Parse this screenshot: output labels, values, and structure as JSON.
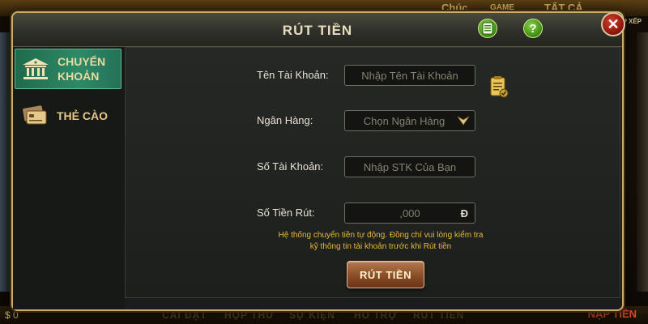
{
  "background": {
    "top_labels": [
      "Chúc",
      "GAME",
      "TẤT CẢ"
    ],
    "sort_label": "SẮP XẾP",
    "bottom_nav": [
      "CÀI ĐẶT",
      "HỘP THƯ",
      "SỰ KIỆN",
      "HỖ TRỢ",
      "RÚT TIỀN"
    ],
    "bottom_right": "NẠP TIỀN",
    "balance": "$ 0"
  },
  "modal": {
    "title": "RÚT TIỀN",
    "header_buttons": {
      "help": "?"
    },
    "close": "✕"
  },
  "sidebar": {
    "tabs": [
      {
        "label_line1": "CHUYỂN",
        "label_line2": "KHOẢN",
        "icon": "bank-icon",
        "active": true
      },
      {
        "label_line1": "THẺ CÀO",
        "label_line2": "",
        "icon": "card-icon",
        "active": false
      }
    ]
  },
  "form": {
    "account_name": {
      "label": "Tên Tài Khoản:",
      "placeholder": "Nhập Tên Tài Khoản"
    },
    "bank": {
      "label": "Ngân Hàng:",
      "value": "Chọn Ngân Hàng"
    },
    "account_number": {
      "label": "Số Tài Khoản:",
      "placeholder": "Nhập STK Của Bạn"
    },
    "amount": {
      "label": "Số Tiền Rút:",
      "value": ",000",
      "currency": "Đ"
    },
    "notice_line1": "Hệ thống chuyển tiền tự động. Đồng chí vui lòng kiểm tra",
    "notice_line2": "kỹ thông tin tài khoản trước khi Rút tiền",
    "submit_label": "RÚT TIỀN"
  },
  "colors": {
    "accent_gold": "#c9ad6e",
    "active_tab": "#2d8a68",
    "notice": "#e7b93a",
    "submit": "#8a4d26"
  }
}
